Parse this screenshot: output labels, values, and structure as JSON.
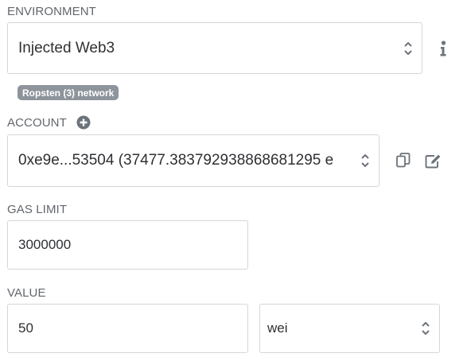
{
  "environment": {
    "label": "ENVIRONMENT",
    "selected": "Injected Web3",
    "network_badge": "Ropsten (3) network"
  },
  "account": {
    "label": "ACCOUNT",
    "selected": "0xe9e...53504 (37477.38379293886868129​5 e"
  },
  "gas_limit": {
    "label": "GAS LIMIT",
    "value": "3000000"
  },
  "value": {
    "label": "VALUE",
    "amount": "50",
    "unit": "wei"
  },
  "icons": {
    "info": "info-icon",
    "add_account": "plus-circle-icon",
    "copy": "copy-icon",
    "edit": "edit-icon",
    "select_arrows": "chevron-up-down-icon"
  },
  "colors": {
    "label": "#62666c",
    "border": "#d3d6da",
    "badge_bg": "#8e949b",
    "icon": "#6c737a"
  }
}
